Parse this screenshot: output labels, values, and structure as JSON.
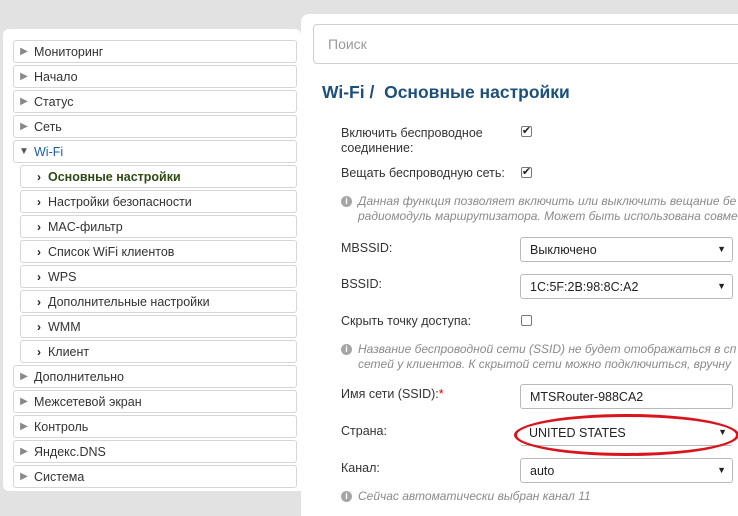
{
  "sidebar": {
    "items": [
      {
        "label": "Мониторинг"
      },
      {
        "label": "Начало"
      },
      {
        "label": "Статус"
      },
      {
        "label": "Сеть"
      },
      {
        "label": "Wi-Fi"
      },
      {
        "label": "Основные настройки"
      },
      {
        "label": "Настройки безопасности"
      },
      {
        "label": "MAC-фильтр"
      },
      {
        "label": "Список WiFi клиентов"
      },
      {
        "label": "WPS"
      },
      {
        "label": "Дополнительные настройки"
      },
      {
        "label": "WMM"
      },
      {
        "label": "Клиент"
      },
      {
        "label": "Дополнительно"
      },
      {
        "label": "Межсетевой экран"
      },
      {
        "label": "Контроль"
      },
      {
        "label": "Яндекс.DNS"
      },
      {
        "label": "Система"
      }
    ]
  },
  "search": {
    "placeholder": "Поиск"
  },
  "page": {
    "breadcrumb": "Wi-Fi /",
    "title": "Основные настройки"
  },
  "form": {
    "enable_wireless": {
      "label_line1": "Включить беспроводное",
      "label_line2": "соединение:",
      "checked": true
    },
    "broadcast": {
      "label": "Вещать беспроводную сеть:",
      "checked": true
    },
    "broadcast_hint_line1": "Данная функция позволяет включить или выключить вещание бе",
    "broadcast_hint_line2": "радиомодуль маршрутизатора. Может быть использована совме",
    "mbssid": {
      "label": "MBSSID:",
      "value": "Выключено"
    },
    "bssid": {
      "label": "BSSID:",
      "value": "1C:5F:2B:98:8C:A2"
    },
    "hide_ap": {
      "label": "Скрыть точку доступа:",
      "checked": false
    },
    "hide_hint_line1": "Название беспроводной сети (SSID) не будет отображаться в сп",
    "hide_hint_line2": "сетей у клиентов. К скрытой сети можно подключиться, вручну",
    "ssid": {
      "label": "Имя сети (SSID):",
      "required_mark": "*",
      "value": "MTSRouter-988CA2"
    },
    "country": {
      "label": "Страна:",
      "value": "UNITED STATES"
    },
    "channel": {
      "label": "Канал:",
      "value": "auto"
    },
    "channel_hint": "Сейчас автоматически выбран канал 11"
  },
  "icons": {
    "check": "✔",
    "caret": "▼",
    "info": "i",
    "collapsed": "▶",
    "expanded": "▼",
    "sub": "›"
  },
  "colors": {
    "accent_title": "#1d4f7c",
    "highlight_ellipse": "#d9141c",
    "current_item": "#2e4a14"
  }
}
